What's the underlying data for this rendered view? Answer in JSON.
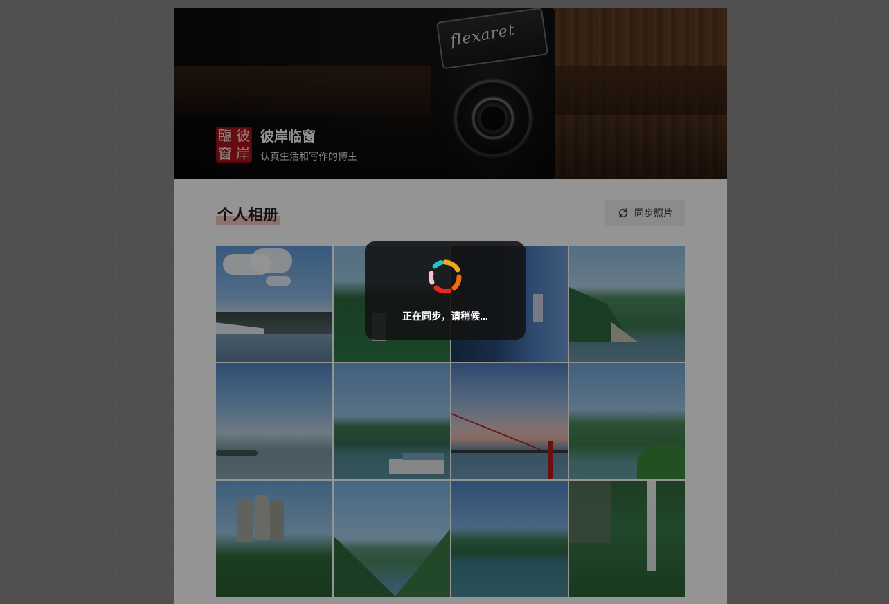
{
  "header": {
    "seal_chars": [
      "臨",
      "彼",
      "窗",
      "岸"
    ],
    "site_title": "彼岸临窗",
    "site_subtitle": "认真生活和写作的博主",
    "camera_brand": "flexaret"
  },
  "album": {
    "title": "个人相册",
    "sync_label": "同步照片"
  },
  "photos": [
    {
      "name": "city-waterfront"
    },
    {
      "name": "green-hills-building"
    },
    {
      "name": "tall-tower"
    },
    {
      "name": "river-gorge"
    },
    {
      "name": "river-sky"
    },
    {
      "name": "harbor-boats"
    },
    {
      "name": "red-bridge"
    },
    {
      "name": "mountain-bridge"
    },
    {
      "name": "rock-pillars"
    },
    {
      "name": "valley-river"
    },
    {
      "name": "lake-mountains"
    },
    {
      "name": "waterfall"
    }
  ],
  "toast": {
    "message": "正在同步，请稍候..."
  },
  "colors": {
    "overlay": "rgba(0,0,0,0.42)",
    "seal_red": "#b0141c",
    "title_highlight": "#f5c7c2"
  }
}
